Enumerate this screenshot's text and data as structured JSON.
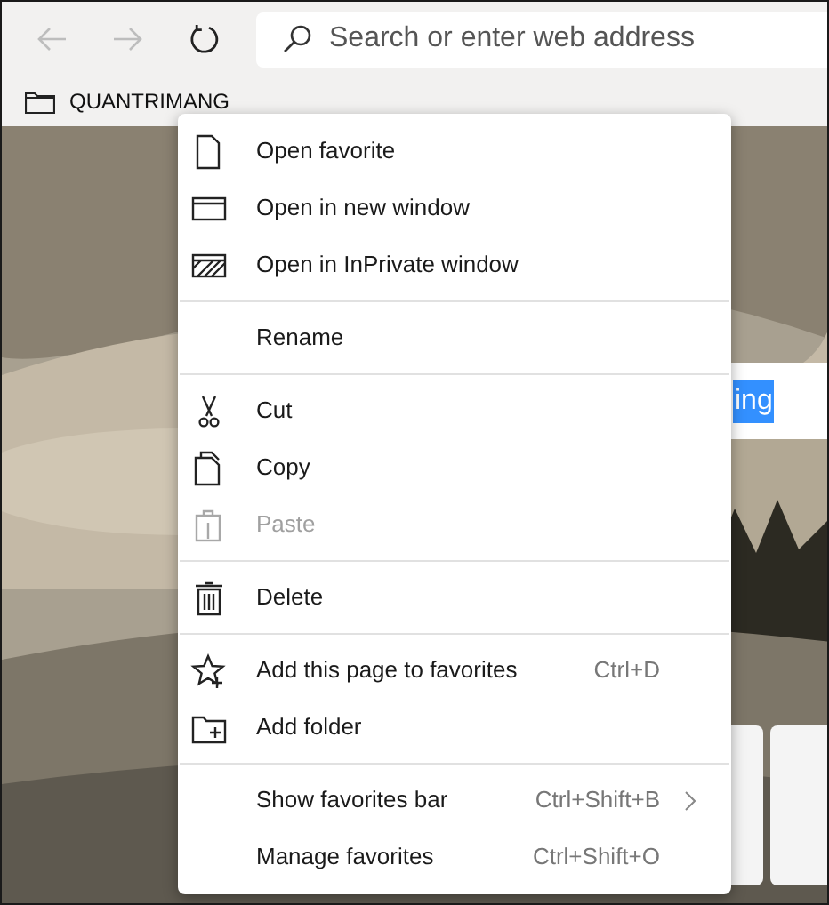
{
  "toolbar": {
    "back": {
      "disabled": true
    },
    "forward": {
      "disabled": true
    },
    "address": {
      "placeholder": "Search or enter web address"
    }
  },
  "favorites_bar": {
    "items": [
      {
        "label": "QUANTRIMANG"
      }
    ]
  },
  "page": {
    "search_box": {
      "value": "ing",
      "selected": true
    }
  },
  "context_menu": {
    "groups": [
      {
        "items": [
          {
            "label": "Open favorite",
            "disabled": false
          },
          {
            "label": "Open in new window",
            "disabled": false
          },
          {
            "label": "Open in InPrivate window",
            "disabled": false
          }
        ]
      },
      {
        "items": [
          {
            "label": "Rename",
            "disabled": false
          }
        ]
      },
      {
        "items": [
          {
            "label": "Cut",
            "disabled": false
          },
          {
            "label": "Copy",
            "disabled": false
          },
          {
            "label": "Paste",
            "disabled": true
          }
        ]
      },
      {
        "items": [
          {
            "label": "Delete",
            "disabled": false
          }
        ]
      },
      {
        "items": [
          {
            "label": "Add this page to favorites",
            "shortcut": "Ctrl+D",
            "disabled": false
          },
          {
            "label": "Add folder",
            "disabled": false
          }
        ]
      },
      {
        "items": [
          {
            "label": "Show favorites bar",
            "shortcut": "Ctrl+Shift+B",
            "submenu": true,
            "disabled": false
          },
          {
            "label": "Manage favorites",
            "shortcut": "Ctrl+Shift+O",
            "disabled": false
          }
        ]
      }
    ]
  }
}
